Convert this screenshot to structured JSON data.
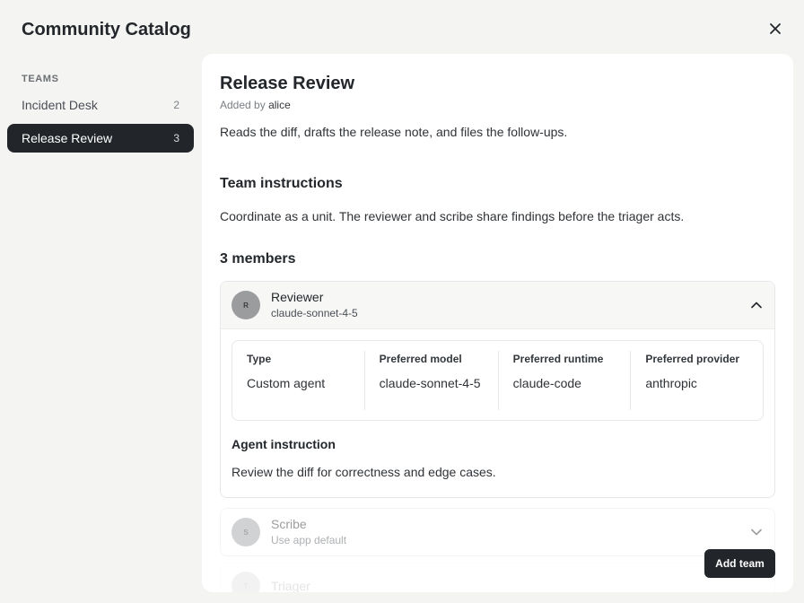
{
  "modal": {
    "title": "Community Catalog",
    "add_button": "Add team"
  },
  "sidebar": {
    "heading": "TEAMS",
    "items": [
      {
        "label": "Incident Desk",
        "count": "2"
      },
      {
        "label": "Release Review",
        "count": "3"
      }
    ]
  },
  "team": {
    "title": "Release Review",
    "added_by_prefix": "Added by",
    "author": "alice",
    "description": "Reads the diff, drafts the release note, and files the follow-ups.",
    "instructions_heading": "Team instructions",
    "instructions": "Coordinate as a unit. The reviewer and scribe share findings before the triager acts.",
    "members_heading": "3 members",
    "members": [
      {
        "initial": "R",
        "name": "Reviewer",
        "model": "claude-sonnet-4-5",
        "props": [
          {
            "label": "Type",
            "value": "Custom agent"
          },
          {
            "label": "Preferred model",
            "value": "claude-sonnet-4-5"
          },
          {
            "label": "Preferred runtime",
            "value": "claude-code"
          },
          {
            "label": "Preferred provider",
            "value": "anthropic"
          }
        ],
        "agent_instruction_label": "Agent instruction",
        "agent_instruction": "Review the diff for correctness and edge cases."
      },
      {
        "initial": "S",
        "name": "Scribe",
        "model": "Use app default"
      },
      {
        "initial": "T",
        "name": "Triager",
        "model": ""
      }
    ]
  }
}
